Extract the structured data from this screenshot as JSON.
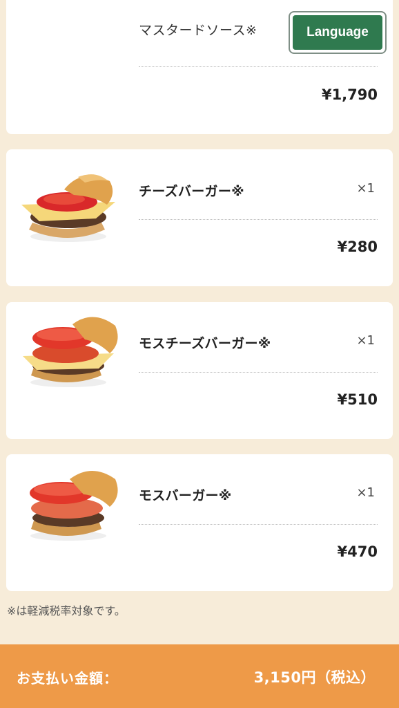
{
  "top_item": {
    "option_text": "マスタードソース※",
    "price": "¥1,790"
  },
  "language_button": {
    "label": "Language"
  },
  "items": [
    {
      "name": "チーズバーガー※",
      "qty": "×1",
      "price": "¥280"
    },
    {
      "name": "モスチーズバーガー※",
      "qty": "×1",
      "price": "¥510"
    },
    {
      "name": "モスバーガー※",
      "qty": "×1",
      "price": "¥470"
    }
  ],
  "note": "※は軽減税率対象です。",
  "footer": {
    "label": "お支払い金額：",
    "total": "3,150円（税込）"
  },
  "colors": {
    "background": "#f7ecd9",
    "language_button": "#2f7a4f",
    "footer": "#ee9a48"
  }
}
